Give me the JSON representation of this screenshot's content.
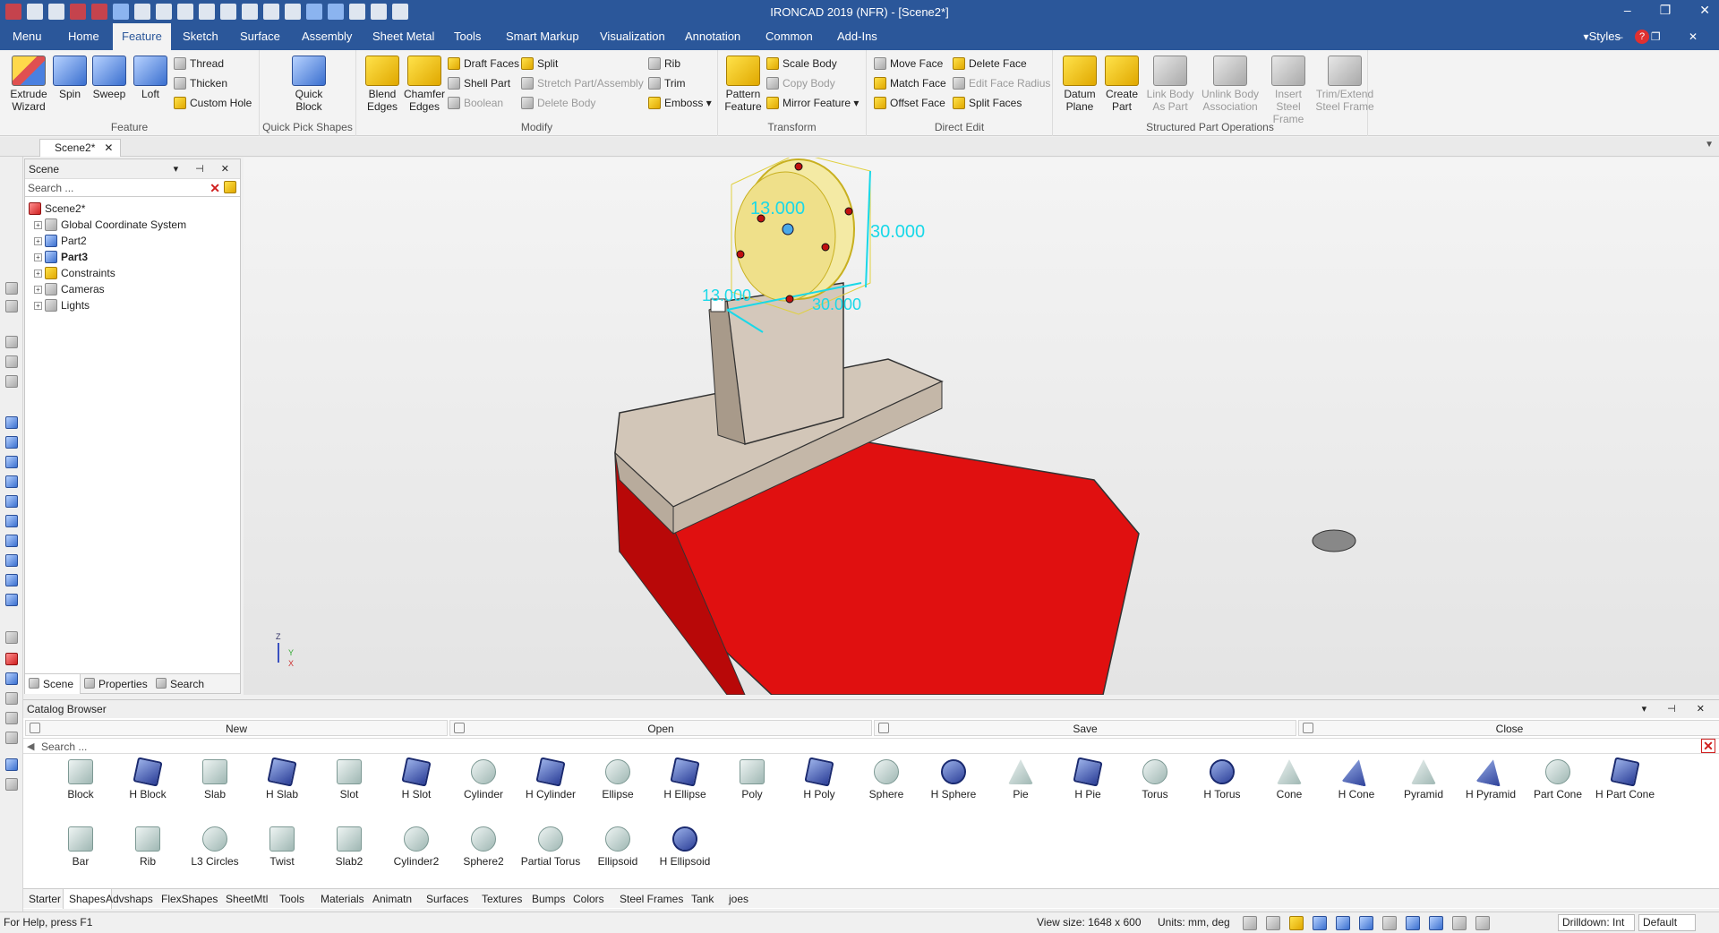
{
  "titlebar": {
    "title": "IRONCAD 2019 (NFR) - [Scene2*]",
    "minimize": "–",
    "restore": "❐",
    "close": "✕"
  },
  "menubar": {
    "tabs": [
      "Menu",
      "Home",
      "Feature",
      "Sketch",
      "Surface",
      "Assembly",
      "Sheet Metal",
      "Tools",
      "Smart Markup",
      "Visualization",
      "Annotation",
      "Common",
      "Add-Ins"
    ],
    "active_tab": "Feature",
    "styles_label": "Styles",
    "help_icon": "?",
    "mini_controls": "▾ – ❐ ✕"
  },
  "ribbon": {
    "feature_group": {
      "label": "Feature",
      "extrude": "Extrude\nWizard",
      "spin": "Spin",
      "sweep": "Sweep",
      "loft": "Loft",
      "thread": "Thread",
      "thicken": "Thicken",
      "custom_hole": "Custom Hole"
    },
    "quick_pick": {
      "label": "Quick Pick Shapes",
      "quick_block": "Quick\nBlock"
    },
    "modify": {
      "label": "Modify",
      "blend": "Blend\nEdges",
      "chamfer": "Chamfer\nEdges",
      "draft_faces": "Draft Faces",
      "shell_part": "Shell Part",
      "boolean": "Boolean",
      "split": "Split",
      "stretch": "Stretch Part/Assembly",
      "delete_body": "Delete Body",
      "rib": "Rib",
      "trim": "Trim",
      "emboss": "Emboss"
    },
    "transform": {
      "label": "Transform",
      "pattern": "Pattern\nFeature",
      "scale_body": "Scale Body",
      "copy_body": "Copy Body",
      "mirror": "Mirror Feature"
    },
    "direct_edit": {
      "label": "Direct Edit",
      "move_face": "Move Face",
      "match_face": "Match Face",
      "offset_face": "Offset Face",
      "delete_face": "Delete Face",
      "edit_face_radius": "Edit Face Radius",
      "split_faces": "Split Faces"
    },
    "structured": {
      "label": "Structured Part Operations",
      "datum_plane": "Datum\nPlane",
      "create_part": "Create\nPart",
      "link_body": "Link Body\nAs Part",
      "unlink_body": "Unlink Body\nAssociation",
      "insert_steel": "Insert Steel\nFrame",
      "trim_extend": "Trim/Extend\nSteel Frame"
    }
  },
  "doctab": {
    "label": "Scene2*",
    "close": "✕"
  },
  "scene_panel": {
    "title": "Scene",
    "controls": "▾ ⊣ ✕",
    "search_placeholder": "Search ...",
    "tree": [
      {
        "label": "Scene2*",
        "bold": false,
        "root": true
      },
      {
        "label": "Global Coordinate System",
        "bold": false
      },
      {
        "label": "Part2",
        "bold": false
      },
      {
        "label": "Part3",
        "bold": true
      },
      {
        "label": "Constraints",
        "bold": false
      },
      {
        "label": "Cameras",
        "bold": false
      },
      {
        "label": "Lights",
        "bold": false
      }
    ],
    "footer_tabs": [
      "Scene",
      "Properties",
      "Search"
    ]
  },
  "viewport": {
    "dims": {
      "d1": "13.000",
      "d2": "30.000",
      "d3": "13.000",
      "d4": "30.000"
    },
    "axis": {
      "z": "Z",
      "y": "Y",
      "x": "X"
    },
    "colors": {
      "dimension": "#19d8e8",
      "base_red": "#e01010",
      "body_tan": "#d2c6b8",
      "selected_yellow": "#f4eaa4"
    }
  },
  "catalog": {
    "title": "Catalog Browser",
    "controls": "▾ ⊣ ✕",
    "buttons": [
      "New",
      "Open",
      "Save",
      "Close"
    ],
    "search_placeholder": "Search ...",
    "row1": [
      "Block",
      "H Block",
      "Slab",
      "H Slab",
      "Slot",
      "H Slot",
      "Cylinder",
      "H Cylinder",
      "Ellipse",
      "H Ellipse",
      "Poly",
      "H Poly",
      "Sphere",
      "H Sphere",
      "Pie",
      "H Pie",
      "Torus",
      "H Torus",
      "Cone",
      "H Cone",
      "Pyramid",
      "H Pyramid",
      "Part Cone",
      "H Part Cone"
    ],
    "row2": [
      "Bar",
      "Rib",
      "L3 Circles",
      "Twist",
      "Slab2",
      "Cylinder2",
      "Sphere2",
      "Partial Torus",
      "Ellipsoid",
      "H Ellipsoid"
    ],
    "tabs": [
      "Starter",
      "Shapes",
      "Advshaps",
      "FlexShapes",
      "SheetMtl",
      "Tools",
      "Materials",
      "Animatn",
      "Surfaces",
      "Textures",
      "Bumps",
      "Colors",
      "Steel Frames",
      "Tank",
      "joes"
    ],
    "active_tab": "Shapes"
  },
  "status": {
    "help": "For Help, press F1",
    "view_size": "View size: 1648 x  600",
    "units": "Units: mm, deg",
    "drilldown": "Drilldown: Int",
    "style": "Default"
  }
}
